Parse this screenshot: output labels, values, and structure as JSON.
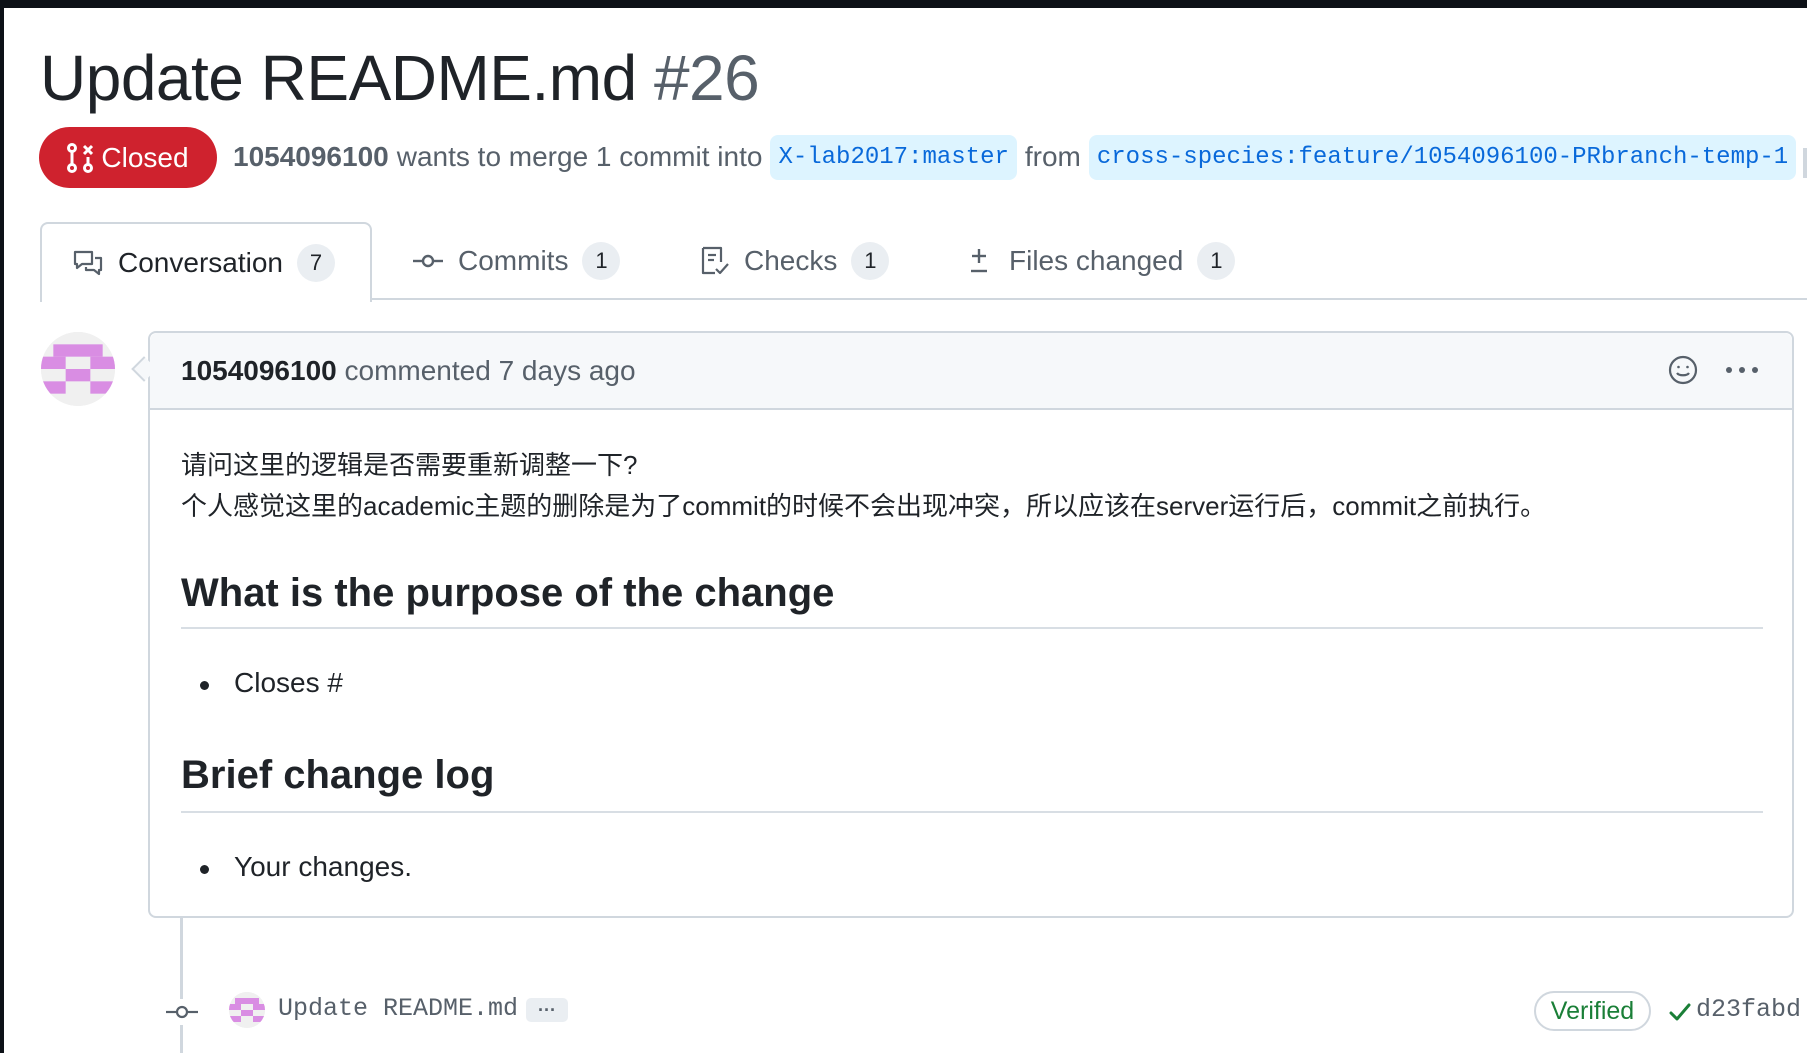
{
  "pr": {
    "title": "Update README.md",
    "number": "#26",
    "state": "Closed",
    "author": "1054096100",
    "merge_text": "wants to merge 1 commit into",
    "base_branch": "X-lab2017:master",
    "from_text": "from",
    "head_branch": "cross-species:feature/1054096100-PRbranch-temp-1"
  },
  "tabs": [
    {
      "label": "Conversation",
      "count": "7",
      "icon": "comment-discussion-icon"
    },
    {
      "label": "Commits",
      "count": "1",
      "icon": "git-commit-icon"
    },
    {
      "label": "Checks",
      "count": "1",
      "icon": "checklist-icon"
    },
    {
      "label": "Files changed",
      "count": "1",
      "icon": "file-diff-icon"
    }
  ],
  "comment": {
    "author": "1054096100",
    "meta": "commented 7 days ago",
    "body_lines": [
      "请问这里的逻辑是否需要重新调整一下?",
      "个人感觉这里的academic主题的删除是为了commit的时候不会出现冲突，所以应该在server运行后，commit之前执行。"
    ],
    "sections": [
      {
        "heading": "What is the purpose of the change",
        "bullet": "Closes #"
      },
      {
        "heading": "Brief change log",
        "bullet": "Your changes."
      }
    ]
  },
  "commit": {
    "message": "Update README.md",
    "ellipsis": "···",
    "verified": "Verified",
    "sha": "d23fabd"
  },
  "colors": {
    "closed_red": "#cf222e",
    "branch_blue": "#0969da",
    "verified_green": "#1a7f37",
    "avatar_purple": "#d98de3"
  }
}
